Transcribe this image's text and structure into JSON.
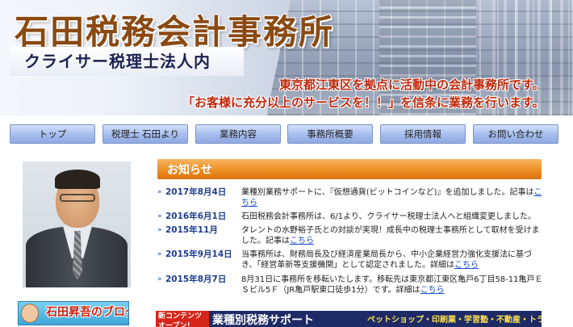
{
  "header": {
    "title": "石田税務会計事務所",
    "subtitle": "クライサー税理士法人内",
    "tagline1": "東京都江東区を拠点に活動中の会計事務所です。",
    "tagline2": "「お客様に充分以上のサービスを！！」を信条に業務を行います。"
  },
  "nav": {
    "items": [
      {
        "label": "トップ"
      },
      {
        "label": "税理士 石田より"
      },
      {
        "label": "業務内容"
      },
      {
        "label": "事務所概要"
      },
      {
        "label": "採用情報"
      },
      {
        "label": "お問い合わせ"
      }
    ]
  },
  "sidebar": {
    "blog_label": "石田昇吾のブログ"
  },
  "news": {
    "heading": "お知らせ",
    "items": [
      {
        "date": "2017年8月4日",
        "text": "業種別業務サポートに、『仮想通貨(ビットコインなど)』を追加しました。記事は",
        "link": "こちら"
      },
      {
        "date": "2016年6月1日",
        "text": "石田税務会計事務所は、6/1より、クライサー税理士法人へと組織変更しました。",
        "link": ""
      },
      {
        "date": "2015年11月",
        "text": "タレントの水野裕子氏との対談が実現！成長中の税理士事務所として取材を受けました。記事は",
        "link": "こちら"
      },
      {
        "date": "2015年9月14日",
        "text": "当事務所は、財務局長及び経済産業局長から、中小企業経営力強化支援法に基づき、「経営革新等支援機関」として認定されました。詳細は",
        "link": "こちら"
      },
      {
        "date": "2015年8月7日",
        "text": "8月31日に事務所を移転いたします。移転先は東京都江東区亀戸6丁目58-11亀戸ＥＳビル5Ｆ（JR亀戸駅東口徒歩1分）です。詳細は",
        "link": "こちら"
      }
    ]
  },
  "promo": {
    "tag": "新コンテンツオープン！",
    "main": "業種別税務サポート",
    "sub": "ペットショップ・印刷業・学習塾・不動産・トラック運送業・スーパーマーケット"
  }
}
